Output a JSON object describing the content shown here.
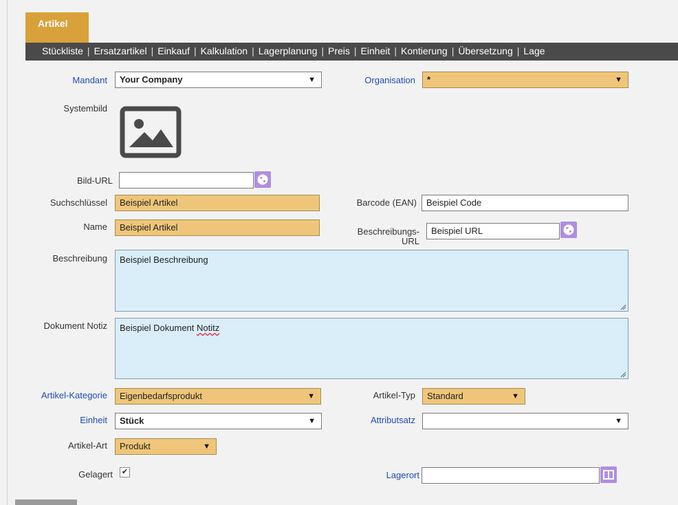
{
  "header": {
    "active_tab": "Artikel",
    "subtabs": [
      "Stückliste",
      "Ersatzartikel",
      "Einkauf",
      "Kalkulation",
      "Lagerplanung",
      "Preis",
      "Einheit",
      "Kontierung",
      "Übersetzung",
      "Lage"
    ]
  },
  "form": {
    "mandant": {
      "label": "Mandant",
      "value": "Your Company"
    },
    "organisation": {
      "label": "Organisation",
      "value": "*"
    },
    "systembild": {
      "label": "Systembild"
    },
    "bild_url": {
      "label": "Bild-URL",
      "value": ""
    },
    "suchschluessel": {
      "label": "Suchschlüssel",
      "value": "Beispiel Artikel"
    },
    "barcode": {
      "label": "Barcode (EAN)",
      "value": "Beispiel Code"
    },
    "name": {
      "label": "Name",
      "value": "Beispiel Artikel"
    },
    "beschreibungs_url": {
      "label_1": "Beschreibungs-",
      "label_2": "URL",
      "value": "Beispiel URL"
    },
    "beschreibung": {
      "label": "Beschreibung",
      "value": "Beispiel Beschreibung"
    },
    "dokument_notiz": {
      "label": "Dokument Notiz",
      "value_prefix": "Beispiel Dokument ",
      "value_underlined": "Notitz"
    },
    "artikel_kategorie": {
      "label": "Artikel-Kategorie",
      "value": "Eigenbedarfsprodukt"
    },
    "artikel_typ": {
      "label": "Artikel-Typ",
      "value": "Standard"
    },
    "einheit": {
      "label": "Einheit",
      "value": "Stück"
    },
    "attributsatz": {
      "label": "Attributsatz",
      "value": ""
    },
    "artikel_art": {
      "label": "Artikel-Art",
      "value": "Produkt"
    },
    "gelagert": {
      "label": "Gelagert",
      "checked": true
    },
    "lagerort": {
      "label": "Lagerort",
      "value": ""
    }
  },
  "icons": {
    "select_caret": "▼",
    "checkmark": "✔",
    "globe_button": "globe-icon",
    "locator_button": "locator-icon",
    "image_placeholder": "image-icon",
    "resize_handle": "resize-grip-icon"
  },
  "colors": {
    "accent": "#d9a13a",
    "tabbar": "#4a4a4a",
    "mandatory_field": "#efc679",
    "text_area": "#d9eef9",
    "link_label": "#1f4bb3",
    "icon_button": "#b08ee0"
  }
}
